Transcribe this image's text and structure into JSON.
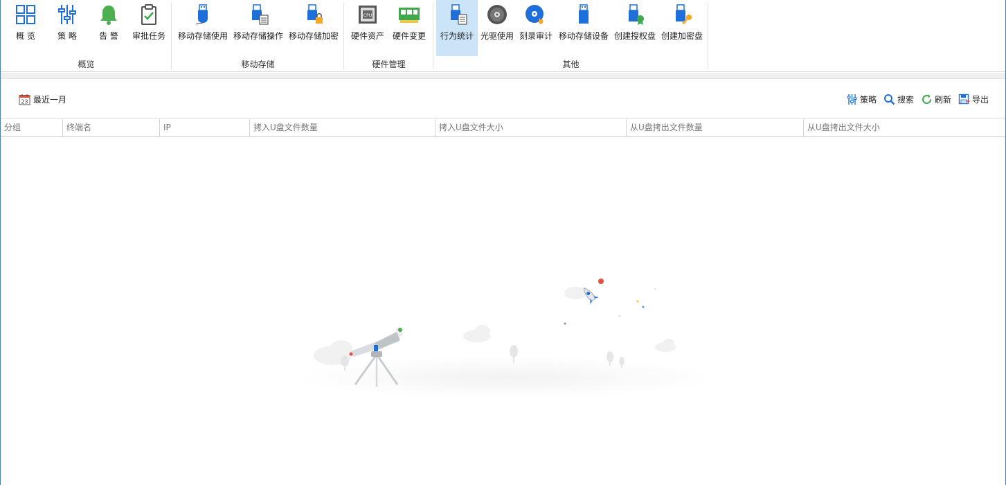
{
  "ribbon": {
    "groups": [
      {
        "label": "概览",
        "buttons": [
          {
            "label": "概 览",
            "icon": "grid-icon"
          },
          {
            "label": "策 略",
            "icon": "sliders-icon"
          },
          {
            "label": "告 警",
            "icon": "bell-icon"
          },
          {
            "label": "审批任务",
            "icon": "clipboard-check-icon"
          }
        ]
      },
      {
        "label": "移动存储",
        "buttons": [
          {
            "label": "移动存储使用",
            "icon": "usb-drive-icon"
          },
          {
            "label": "移动存储操作",
            "icon": "usb-drive-doc-icon"
          },
          {
            "label": "移动存储加密",
            "icon": "usb-drive-lock-icon"
          }
        ]
      },
      {
        "label": "硬件管理",
        "buttons": [
          {
            "label": "硬件资产",
            "icon": "cpu-icon"
          },
          {
            "label": "硬件变更",
            "icon": "memory-card-icon"
          }
        ]
      },
      {
        "label": "其他",
        "buttons": [
          {
            "label": "行为统计",
            "icon": "usb-drive-stats-icon",
            "active": true
          },
          {
            "label": "光驱使用",
            "icon": "disc-icon"
          },
          {
            "label": "刻录审计",
            "icon": "disc-burn-icon"
          },
          {
            "label": "移动存储设备",
            "icon": "usb-device-icon"
          },
          {
            "label": "创建授权盘",
            "icon": "usb-drive-badge-icon"
          },
          {
            "label": "创建加密盘",
            "icon": "usb-drive-key-icon"
          }
        ]
      }
    ]
  },
  "toolbar": {
    "date_range": {
      "label": "最近一月",
      "calendar_day": "23"
    },
    "strategy": "策略",
    "search": "搜索",
    "refresh": "刷新",
    "export": "导出"
  },
  "table": {
    "columns": [
      "分组",
      "终端名",
      "IP",
      "拷入U盘文件数量",
      "拷入U盘文件大小",
      "从U盘拷出文件数量",
      "从U盘拷出文件大小"
    ],
    "rows": []
  },
  "colors": {
    "accent": "#1e6fd9",
    "active_tab": "#cce4f7",
    "green": "#3fa84a",
    "bell": "#4caf50"
  }
}
